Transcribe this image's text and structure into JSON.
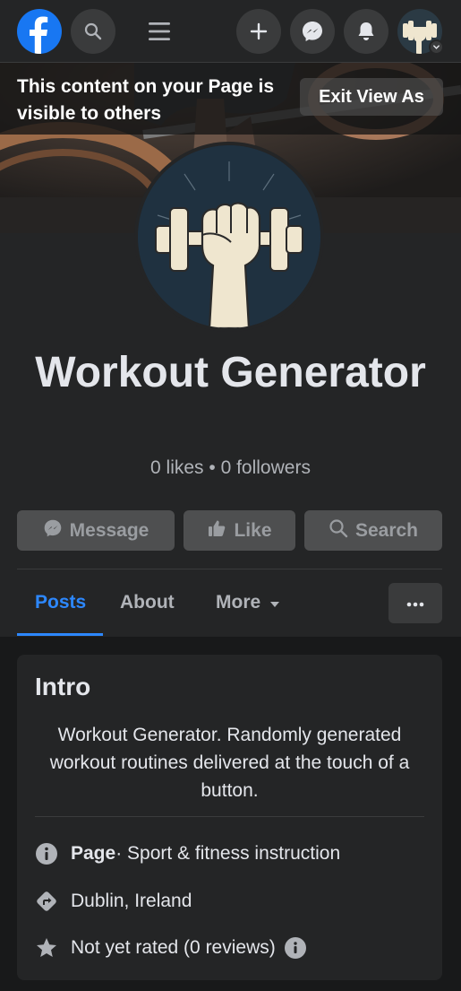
{
  "notice": {
    "text": "This content on your Page is visible to others",
    "exit_label": "Exit View As"
  },
  "page": {
    "name": "Workout Generator",
    "stats": "0 likes • 0 followers"
  },
  "actions": {
    "message_label": "Message",
    "like_label": "Like",
    "search_label": "Search"
  },
  "tabs": {
    "posts_label": "Posts",
    "about_label": "About",
    "more_label": "More"
  },
  "intro": {
    "title": "Intro",
    "bio": "Workout Generator. Randomly generated workout routines delivered at the touch of a button.",
    "category_bold": "Page",
    "category_rest": " · Sport & fitness instruction",
    "location": "Dublin, Ireland",
    "rating": "Not yet rated (0 reviews)"
  },
  "colors": {
    "facebook_blue": "#1877f2",
    "accent_blue": "#2d88ff",
    "background": "#18191a",
    "surface": "#242526"
  },
  "icons": [
    "facebook-logo-icon",
    "search-icon",
    "menu-icon",
    "plus-icon",
    "messenger-icon",
    "bell-icon",
    "chevron-down-icon",
    "thumbs-up-icon",
    "info-icon",
    "directions-icon",
    "star-icon",
    "more-dots-icon",
    "caret-down-icon"
  ]
}
